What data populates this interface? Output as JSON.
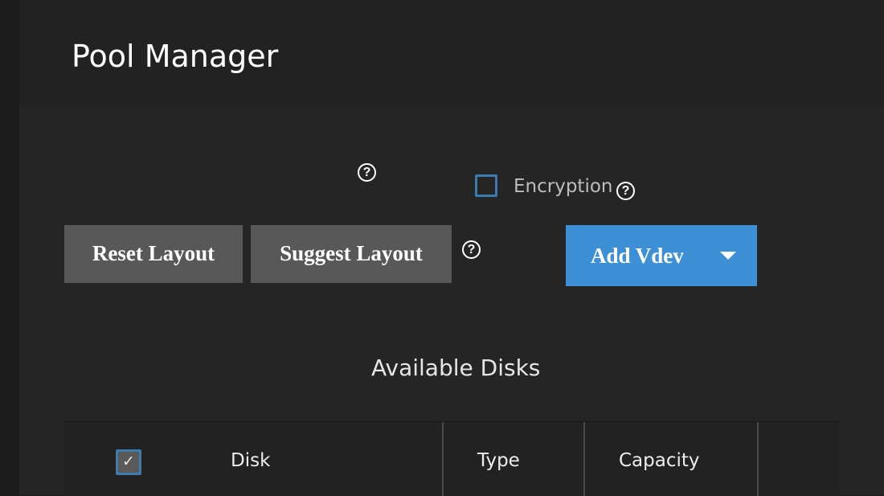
{
  "header": {
    "title": "Pool Manager"
  },
  "options": {
    "encryption_label": "Encryption",
    "encryption_checked": false
  },
  "toolbar": {
    "reset_label": "Reset Layout",
    "suggest_label": "Suggest Layout",
    "add_vdev_label": "Add Vdev"
  },
  "help": {
    "glyph": "?"
  },
  "available_disks": {
    "title": "Available Disks",
    "select_all_checked": true,
    "columns": [
      "Disk",
      "Type",
      "Capacity"
    ]
  },
  "colors": {
    "accent": "#3d90d6",
    "checkbox_border": "#3b7bb0",
    "button_gray": "#585858",
    "background": "#252525"
  }
}
